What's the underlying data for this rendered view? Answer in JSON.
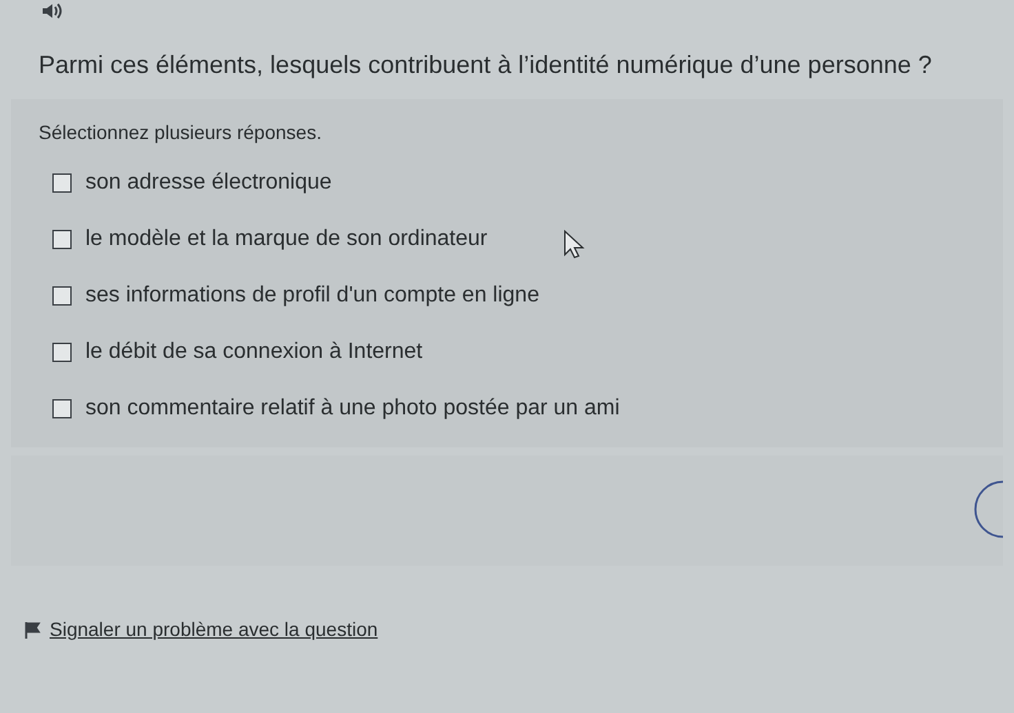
{
  "question": "Parmi ces éléments, lesquels contribuent à l’identité numérique d’une personne ?",
  "instruction": "Sélectionnez plusieurs réponses.",
  "options": [
    {
      "label": "son adresse électronique",
      "checked": false
    },
    {
      "label": "le modèle et la marque de son ordinateur",
      "checked": false
    },
    {
      "label": "ses informations de profil d'un compte en ligne",
      "checked": false
    },
    {
      "label": "le débit de sa connexion à Internet",
      "checked": false
    },
    {
      "label": "son commentaire relatif à une photo postée par un ami",
      "checked": false
    }
  ],
  "report_link": "Signaler un problème avec la question"
}
